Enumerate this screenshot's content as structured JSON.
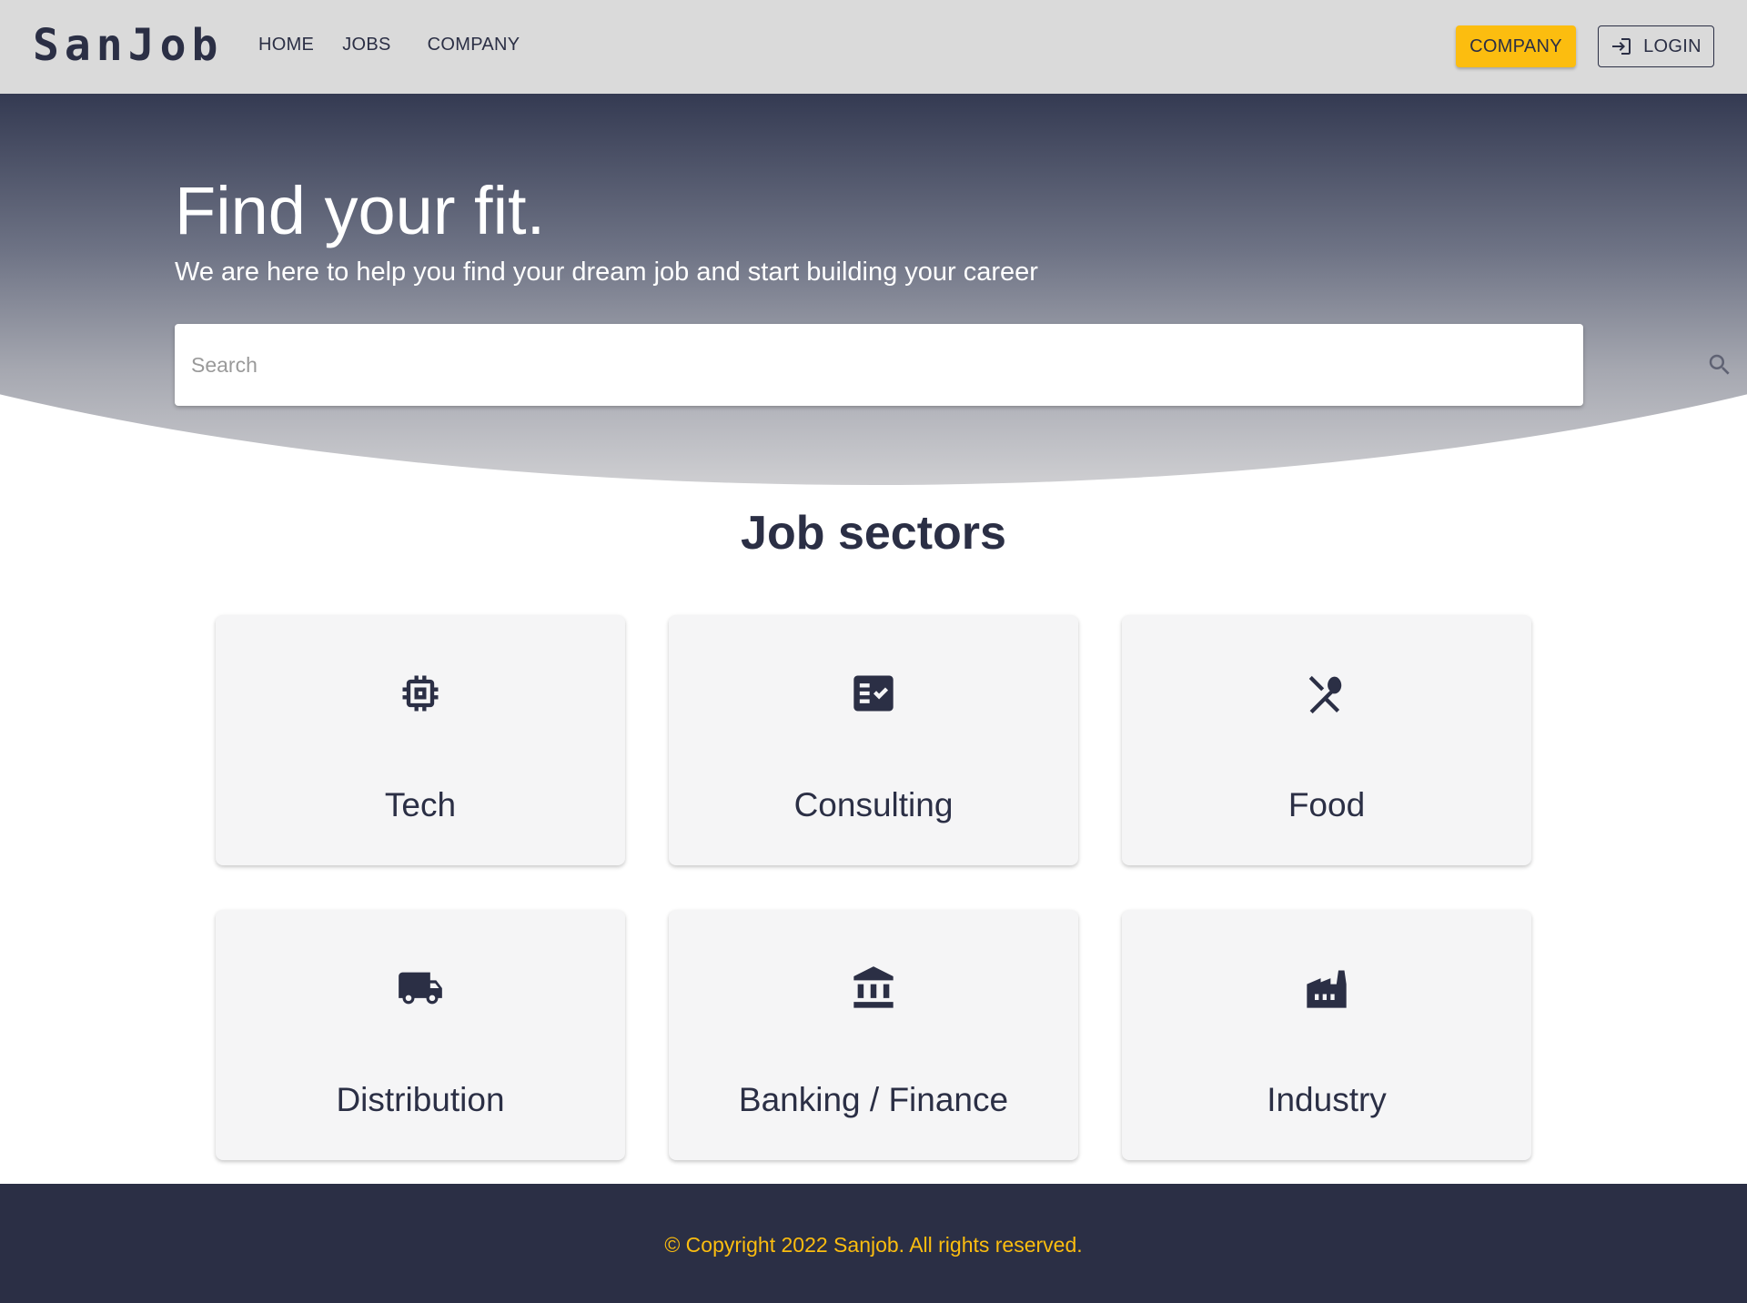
{
  "header": {
    "logo": "SanJob",
    "nav": [
      {
        "label": "HOME"
      },
      {
        "label": "JOBS"
      },
      {
        "label": "COMPANY"
      }
    ],
    "company_button": "COMPANY",
    "login_button": "LOGIN",
    "login_icon": "login-icon"
  },
  "hero": {
    "title": "Find your fit.",
    "subtitle": "We are here to help you find your dream job and start building your career",
    "search": {
      "placeholder": "Search",
      "value": "",
      "icon": "search-icon"
    }
  },
  "sectors": {
    "title": "Job sectors",
    "items": [
      {
        "label": "Tech",
        "icon": "chip-icon"
      },
      {
        "label": "Consulting",
        "icon": "checklist-icon"
      },
      {
        "label": "Food",
        "icon": "restaurant-icon"
      },
      {
        "label": "Distribution",
        "icon": "truck-icon"
      },
      {
        "label": "Banking / Finance",
        "icon": "bank-icon"
      },
      {
        "label": "Industry",
        "icon": "factory-icon"
      }
    ]
  },
  "footer": {
    "copyright": "© Copyright 2022 Sanjob. All rights reserved."
  },
  "colors": {
    "primary_dark": "#2b2f45",
    "accent": "#fcbd0f",
    "header_bg": "#dadada",
    "card_bg": "#f5f5f6"
  }
}
